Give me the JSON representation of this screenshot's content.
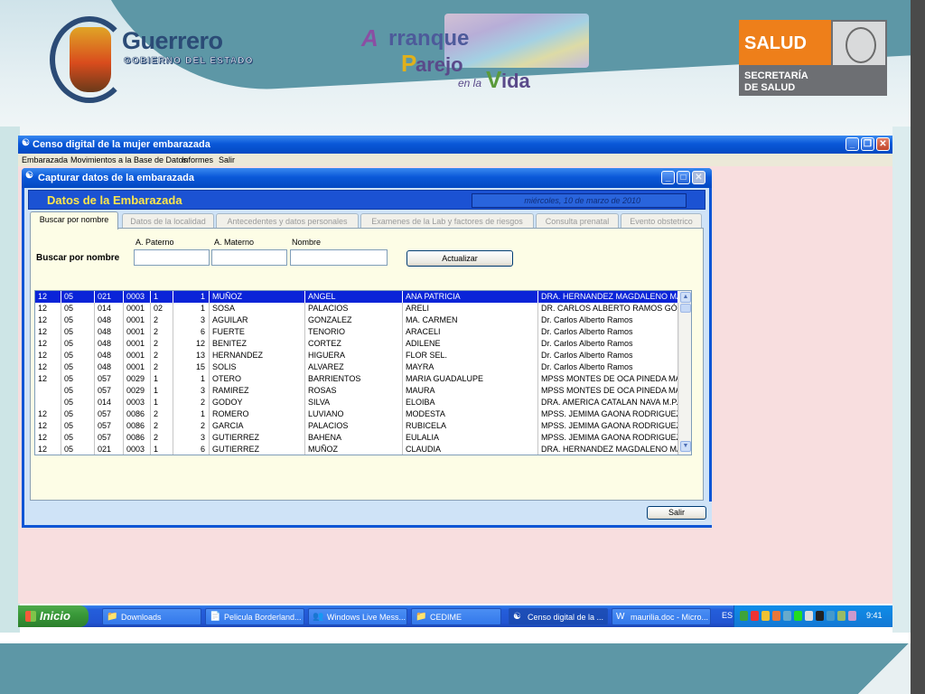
{
  "logos": {
    "guerrero_title": "Guerrero",
    "guerrero_subtitle": "GOBIERNO DEL ESTADO",
    "arranque": {
      "a": "A",
      "rranque": "rranque",
      "p": "P",
      "arejo": "arejo",
      "en_la": "en la",
      "v": "V",
      "ida": "ida"
    },
    "salud": {
      "title": "SALUD",
      "sub1": "SECRETARÍA",
      "sub2": "DE SALUD"
    }
  },
  "main_window": {
    "title": "Censo digital de la mujer embarazada",
    "menu": [
      "Embarazada",
      "Movimientos a la Base de Datos",
      "Informes",
      "Salir"
    ]
  },
  "dialog": {
    "title": "Capturar datos de la embarazada",
    "header": "Datos de la Embarazada",
    "date": "miércoles, 10 de marzo de 2010",
    "tabs": [
      "Buscar por nombre",
      "Datos de la localidad",
      "Antecedentes y datos personales",
      "Examenes de la Lab y factores de riesgos",
      "Consulta prenatal",
      "Evento obstetrico"
    ],
    "search": {
      "label": "Buscar por nombre",
      "paterno_label": "A. Paterno",
      "materno_label": "A. Materno",
      "nombre_label": "Nombre",
      "paterno_value": "",
      "materno_value": "",
      "nombre_value": "",
      "update_button": "Actualizar"
    },
    "rows": [
      [
        "12",
        "05",
        "021",
        "0003",
        "1",
        "1",
        "MUÑOZ",
        "ANGEL",
        "ANA PATRICIA",
        "DRA. HERNANDEZ MAGDALENO MA"
      ],
      [
        "12",
        "05",
        "014",
        "0001",
        "02",
        "1",
        "SOSA",
        "PALACIOS",
        "ARELI",
        "DR. CARLOS ALBERTO RAMOS GÓM"
      ],
      [
        "12",
        "05",
        "048",
        "0001",
        "2",
        "3",
        "AGUILAR",
        "GONZALEZ",
        "MA. CARMEN",
        "Dr. Carlos Alberto Ramos"
      ],
      [
        "12",
        "05",
        "048",
        "0001",
        "2",
        "6",
        "FUERTE",
        "TENORIO",
        "ARACELI",
        "Dr. Carlos Alberto Ramos"
      ],
      [
        "12",
        "05",
        "048",
        "0001",
        "2",
        "12",
        "BENITEZ",
        "CORTEZ",
        "ADILENE",
        "Dr. Carlos Alberto Ramos"
      ],
      [
        "12",
        "05",
        "048",
        "0001",
        "2",
        "13",
        "HERNANDEZ",
        "HIGUERA",
        "FLOR SEL.",
        "Dr. Carlos Alberto Ramos"
      ],
      [
        "12",
        "05",
        "048",
        "0001",
        "2",
        "15",
        "SOLIS",
        "ALVAREZ",
        "MAYRA",
        "Dr. Carlos Alberto Ramos"
      ],
      [
        "12",
        "05",
        "057",
        "0029",
        "1",
        "1",
        "OTERO",
        "BARRIENTOS",
        "MARIA GUADALUPE",
        "MPSS MONTES DE OCA PINEDA MA"
      ],
      [
        "",
        "05",
        "057",
        "0029",
        "1",
        "3",
        "RAMIREZ",
        "ROSAS",
        "MAURA",
        "MPSS MONTES DE OCA PINEDA MA"
      ],
      [
        "",
        "05",
        "014",
        "0003",
        "1",
        "2",
        "GODOY",
        "SILVA",
        "ELOIBA",
        "DRA. AMERICA CATALAN NAVA M.P.S"
      ],
      [
        "12",
        "05",
        "057",
        "0086",
        "2",
        "1",
        "ROMERO",
        "LUVIANO",
        "MODESTA",
        "MPSS. JEMIMA GAONA RODRIGUEZ"
      ],
      [
        "12",
        "05",
        "057",
        "0086",
        "2",
        "2",
        "GARCIA",
        "PALACIOS",
        "RUBICELA",
        "MPSS. JEMIMA GAONA RODRIGUEZ"
      ],
      [
        "12",
        "05",
        "057",
        "0086",
        "2",
        "3",
        "GUTIERREZ",
        "BAHENA",
        "EULALIA",
        "MPSS. JEMIMA GAONA RODRIGUEZ"
      ],
      [
        "12",
        "05",
        "021",
        "0003",
        "1",
        "6",
        "GUTIERREZ",
        "MUÑOZ",
        "CLAUDIA",
        "DRA. HERNANDEZ MAGDALENO MA"
      ]
    ],
    "exit_button": "Salir"
  },
  "taskbar": {
    "start": "Inicio",
    "items": [
      "Downloads",
      "Pelicula Borderland...",
      "Windows Live Mess...",
      "CEDIME",
      "Censo digital de la ...",
      "maurilia.doc - Micro..."
    ],
    "lang": "ES",
    "clock": "9:41"
  },
  "colors": {
    "titlebar": "#0a58d8",
    "selection": "#0a24d8",
    "header_text": "#ffe74a",
    "panel": "#fdfde6",
    "salud_orange": "#ee7f1a"
  }
}
